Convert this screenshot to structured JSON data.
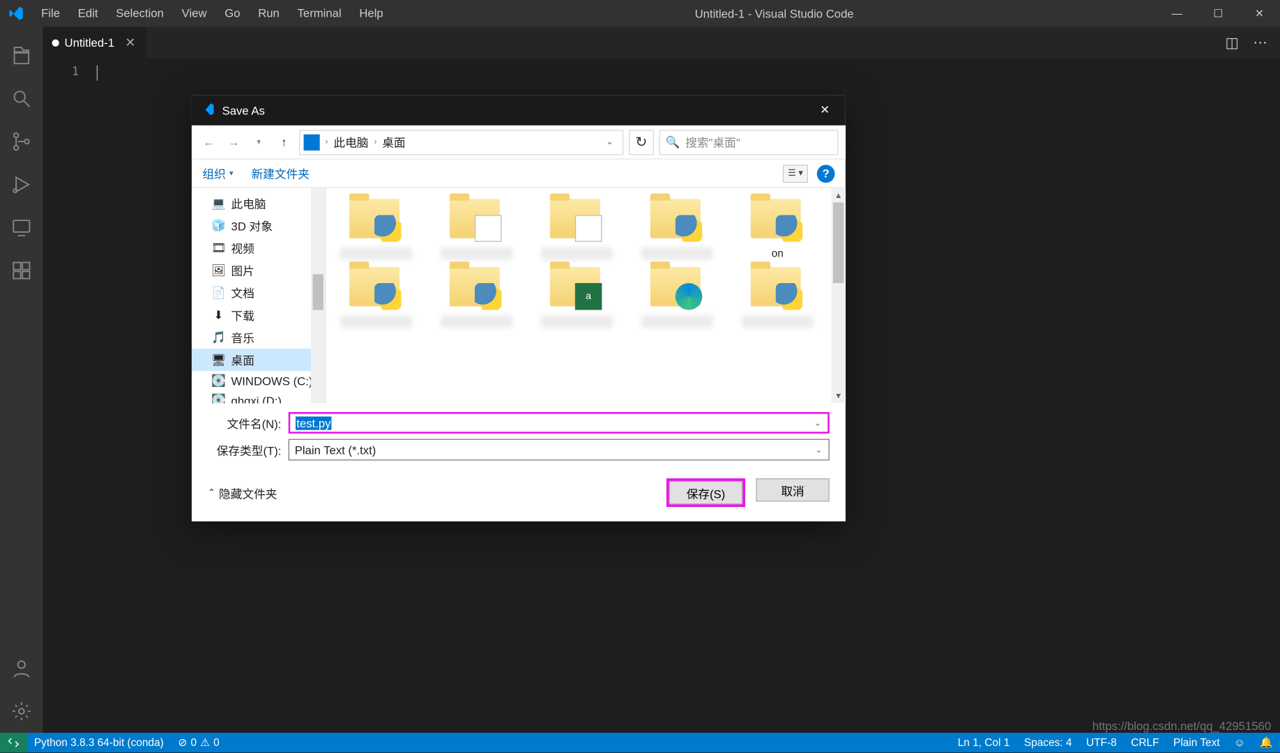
{
  "titlebar": {
    "menus": [
      "File",
      "Edit",
      "Selection",
      "View",
      "Go",
      "Run",
      "Terminal",
      "Help"
    ],
    "title": "Untitled-1 - Visual Studio Code"
  },
  "tab": {
    "name": "Untitled-1"
  },
  "editor": {
    "line_number": "1"
  },
  "dialog": {
    "title": "Save As",
    "breadcrumb": {
      "root": "此电脑",
      "current": "桌面"
    },
    "search_placeholder": "搜索\"桌面\"",
    "toolbar": {
      "organize": "组织",
      "new_folder": "新建文件夹"
    },
    "tree": [
      {
        "icon": "💻",
        "label": "此电脑"
      },
      {
        "icon": "🧊",
        "label": "3D 对象"
      },
      {
        "icon": "🎞",
        "label": "视频"
      },
      {
        "icon": "🖼",
        "label": "图片"
      },
      {
        "icon": "📄",
        "label": "文档"
      },
      {
        "icon": "⬇",
        "label": "下载"
      },
      {
        "icon": "🎵",
        "label": "音乐"
      },
      {
        "icon": "🖥",
        "label": "桌面",
        "selected": true
      },
      {
        "icon": "💽",
        "label": "WINDOWS (C:)"
      },
      {
        "icon": "💽",
        "label": "ghgxj (D:)"
      }
    ],
    "files_row1": [
      {
        "overlay": "py",
        "blurred": true
      },
      {
        "overlay": "doc",
        "blurred": true
      },
      {
        "overlay": "doc",
        "blurred": true
      },
      {
        "overlay": "py",
        "blurred": true
      },
      {
        "overlay": "py",
        "label": "on"
      }
    ],
    "files_row2": [
      {
        "overlay": "py"
      },
      {
        "overlay": "py"
      },
      {
        "overlay": "excel"
      },
      {
        "overlay": "edge"
      },
      {
        "overlay": "py"
      }
    ],
    "filename_label": "文件名(N):",
    "filename_value": "test.py",
    "savetype_label": "保存类型(T):",
    "savetype_value": "Plain Text (*.txt)",
    "hide_folders": "隐藏文件夹",
    "save_btn": "保存(S)",
    "cancel_btn": "取消"
  },
  "statusbar": {
    "python": "Python 3.8.3 64-bit (conda)",
    "errors": "0",
    "warnings": "0",
    "ln_col": "Ln 1, Col 1",
    "spaces": "Spaces: 4",
    "encoding": "UTF-8",
    "eol": "CRLF",
    "lang": "Plain Text"
  },
  "watermark": "https://blog.csdn.net/qq_42951560"
}
